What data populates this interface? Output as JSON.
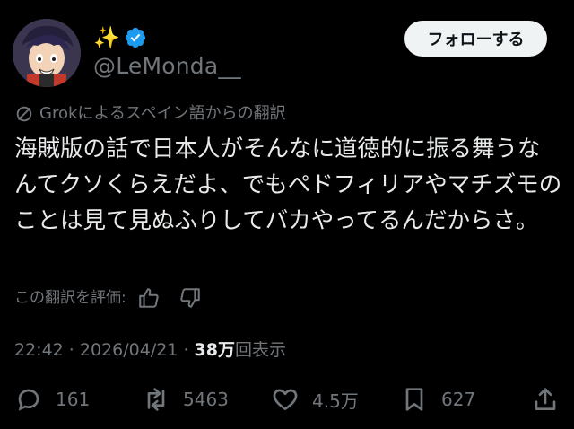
{
  "author": {
    "display_name": "✨",
    "handle": "@LeMonda__",
    "verified_color": "#1d9bf0",
    "name_color": "#f4d35e"
  },
  "follow_button": {
    "label": "フォローする"
  },
  "translation": {
    "note": "Grokによるスペイン語からの翻訳",
    "icon": "translate-icon"
  },
  "post": {
    "text": "海賊版の話で日本人がそんなに道徳的に振る舞うなんてクソくらえだよ、でもペドフィリアやマチズモのことは見て見ぬふりしてバカやってるんだからさ。"
  },
  "rating": {
    "label": "この翻訳を評価:",
    "up_icon": "thumbs-up-icon",
    "down_icon": "thumbs-down-icon"
  },
  "meta": {
    "time": "22:42",
    "separator": " · ",
    "date": "2026/04/21",
    "views_count": "38万",
    "views_label": "回表示"
  },
  "actions": {
    "replies": "161",
    "reposts": "5463",
    "likes": "4.5万",
    "bookmarks": "627"
  },
  "colors": {
    "background": "#000000",
    "primary_text": "#e7e9ea",
    "secondary_text": "#71767b",
    "button_bg": "#eff3f4"
  }
}
